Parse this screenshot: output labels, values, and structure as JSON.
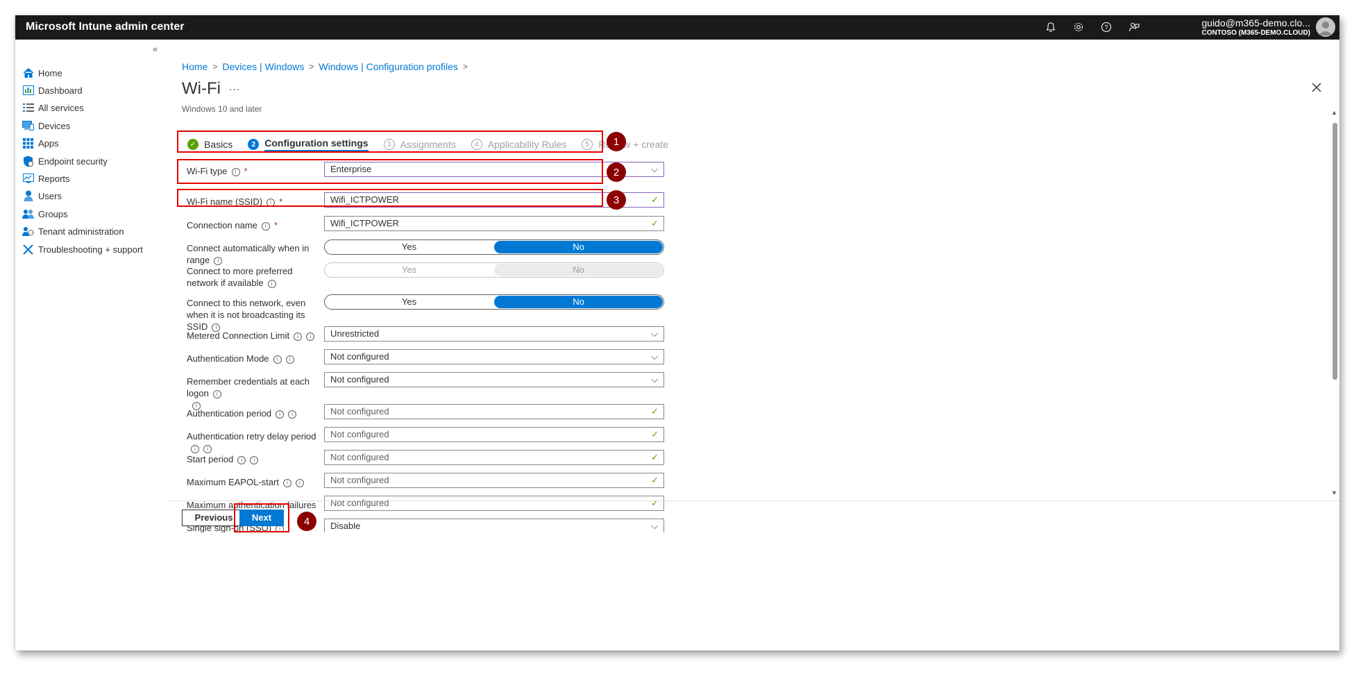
{
  "app": {
    "title": "Microsoft Intune admin center"
  },
  "account": {
    "email": "guido@m365-demo.clo...",
    "tenant": "CONTOSO (M365-DEMO.CLOUD)"
  },
  "topbar": {
    "icons": [
      "bell-icon",
      "gear-icon",
      "help-icon",
      "feedback-icon"
    ]
  },
  "nav": {
    "collapse_label": "«",
    "items": [
      {
        "label": "Home",
        "icon": "home-icon"
      },
      {
        "label": "Dashboard",
        "icon": "dashboard-icon"
      },
      {
        "label": "All services",
        "icon": "all-services-icon"
      },
      {
        "label": "Devices",
        "icon": "devices-icon"
      },
      {
        "label": "Apps",
        "icon": "apps-icon"
      },
      {
        "label": "Endpoint security",
        "icon": "shield-icon"
      },
      {
        "label": "Reports",
        "icon": "reports-icon"
      },
      {
        "label": "Users",
        "icon": "user-icon"
      },
      {
        "label": "Groups",
        "icon": "groups-icon"
      },
      {
        "label": "Tenant administration",
        "icon": "tenant-admin-icon"
      },
      {
        "label": "Troubleshooting + support",
        "icon": "wrench-icon"
      }
    ]
  },
  "breadcrumb": [
    "Home",
    "Devices | Windows",
    "Windows | Configuration profiles"
  ],
  "page": {
    "title": "Wi-Fi",
    "more": "...",
    "subtitle": "Windows 10 and later"
  },
  "steps": [
    {
      "num": "✓",
      "label": "Basics",
      "state": "done"
    },
    {
      "num": "2",
      "label": "Configuration settings",
      "state": "active"
    },
    {
      "num": "3",
      "label": "Assignments",
      "state": "future"
    },
    {
      "num": "4",
      "label": "Applicability Rules",
      "state": "future"
    },
    {
      "num": "5",
      "label": "Review + create",
      "state": "future"
    }
  ],
  "form": {
    "wifi_type": {
      "label": "Wi-Fi type",
      "value": "Enterprise"
    },
    "ssid": {
      "label": "Wi-Fi name (SSID)",
      "value": "Wifi_ICTPOWER"
    },
    "connection_name": {
      "label": "Connection name",
      "value": "Wifi_ICTPOWER"
    },
    "connect_auto": {
      "label": "Connect automatically when in range",
      "yes": "Yes",
      "no": "No",
      "selected": "No"
    },
    "connect_preferred": {
      "label": "Connect to more preferred network if available",
      "yes": "Yes",
      "no": "No",
      "selected": "none"
    },
    "connect_hidden": {
      "label": "Connect to this network, even when it is not broadcasting its SSID",
      "yes": "Yes",
      "no": "No",
      "selected": "No"
    },
    "metered": {
      "label": "Metered Connection Limit",
      "value": "Unrestricted"
    },
    "auth_mode": {
      "label": "Authentication Mode",
      "value": "Not configured"
    },
    "remember_creds": {
      "label": "Remember credentials at each logon",
      "value": "Not configured"
    },
    "auth_period": {
      "label": "Authentication period",
      "placeholder": "Not configured"
    },
    "auth_retry": {
      "label": "Authentication retry delay period",
      "placeholder": "Not configured"
    },
    "start_period": {
      "label": "Start period",
      "placeholder": "Not configured"
    },
    "max_eapol": {
      "label": "Maximum EAPOL-start",
      "placeholder": "Not configured"
    },
    "max_auth_fail": {
      "label": "Maximum authentication failures",
      "placeholder": "Not configured"
    },
    "sso": {
      "label": "Single sign-on (SSO)",
      "value": "Disable"
    }
  },
  "annotations": [
    "1",
    "2",
    "3",
    "4"
  ],
  "buttons": {
    "previous": "Previous",
    "next": "Next"
  },
  "colors": {
    "accent": "#0078d4",
    "annotation": "#8b0000",
    "highlight": "#e60000",
    "success": "#57a300"
  }
}
